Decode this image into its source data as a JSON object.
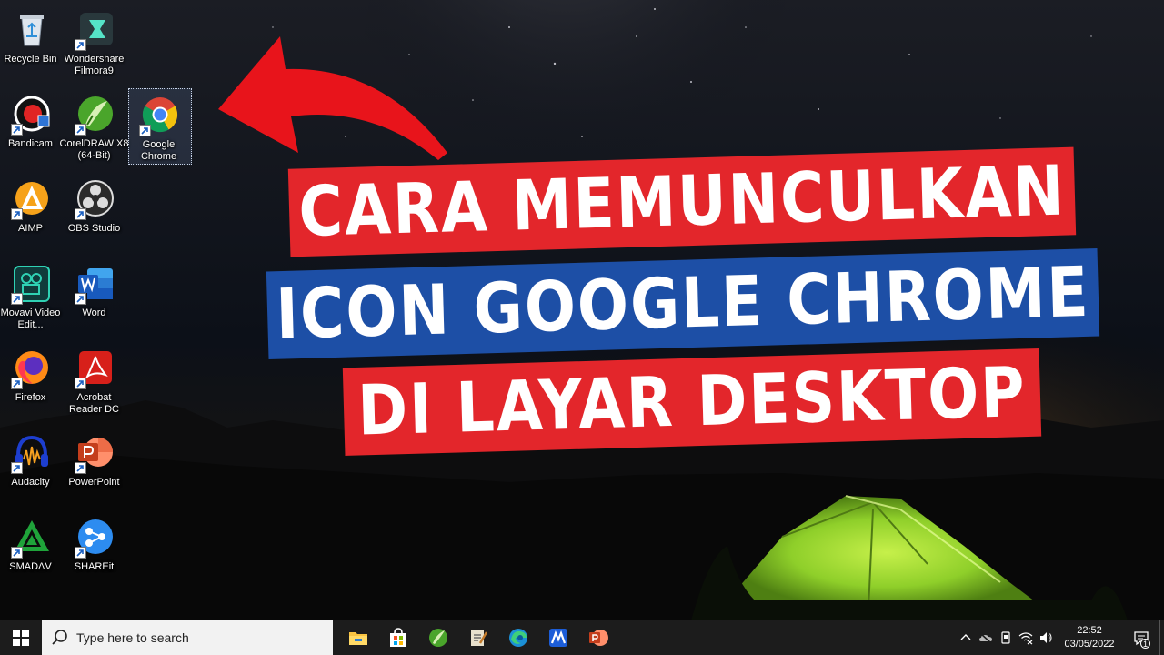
{
  "desktop": {
    "icons": [
      {
        "id": "recycle-bin",
        "label": "Recycle Bin",
        "icon": "recycle-bin-icon",
        "shortcut": false
      },
      {
        "id": "filmora",
        "label": "Wondershare Filmora9",
        "icon": "filmora-icon",
        "shortcut": true
      },
      {
        "id": "bandicam",
        "label": "Bandicam",
        "icon": "bandicam-icon",
        "shortcut": true
      },
      {
        "id": "coreldraw",
        "label": "CorelDRAW X8 (64-Bit)",
        "icon": "coreldraw-icon",
        "shortcut": true
      },
      {
        "id": "chrome",
        "label": "Google Chrome",
        "icon": "chrome-icon",
        "shortcut": true,
        "selected": true
      },
      {
        "id": "aimp",
        "label": "AIMP",
        "icon": "aimp-icon",
        "shortcut": true
      },
      {
        "id": "obs",
        "label": "OBS Studio",
        "icon": "obs-icon",
        "shortcut": true
      },
      {
        "id": "movavi",
        "label": "Movavi Video Edit...",
        "icon": "movavi-icon",
        "shortcut": true
      },
      {
        "id": "word",
        "label": "Word",
        "icon": "word-icon",
        "shortcut": true
      },
      {
        "id": "firefox",
        "label": "Firefox",
        "icon": "firefox-icon",
        "shortcut": true
      },
      {
        "id": "acrobat",
        "label": "Acrobat Reader DC",
        "icon": "acrobat-icon",
        "shortcut": true
      },
      {
        "id": "audacity",
        "label": "Audacity",
        "icon": "audacity-icon",
        "shortcut": true
      },
      {
        "id": "powerpoint",
        "label": "PowerPoint",
        "icon": "powerpoint-icon",
        "shortcut": true
      },
      {
        "id": "smadav",
        "label": "SMADΔV",
        "icon": "smadav-icon",
        "shortcut": true
      },
      {
        "id": "shareit",
        "label": "SHAREit",
        "icon": "shareit-icon",
        "shortcut": true
      }
    ]
  },
  "headline": {
    "line1": "CARA MEMUNCULKAN",
    "line2": "ICON GOOGLE CHROME",
    "line3": "DI LAYAR DESKTOP",
    "colors": {
      "red": "#e3262b",
      "blue": "#1d4fa6",
      "arrow": "#e8141b"
    }
  },
  "taskbar": {
    "search_placeholder": "Type here to search",
    "pinned": [
      "file-explorer-icon",
      "microsoft-store-icon",
      "coreldraw-icon",
      "script-editor-icon",
      "edge-icon",
      "movavi-icon",
      "powerpoint-icon"
    ],
    "tray": [
      "chevron-up-icon",
      "cloud-off-icon",
      "device-icon",
      "wifi-off-icon",
      "volume-icon"
    ],
    "time": "22:52",
    "date": "03/05/2022",
    "notification_count": "1"
  }
}
